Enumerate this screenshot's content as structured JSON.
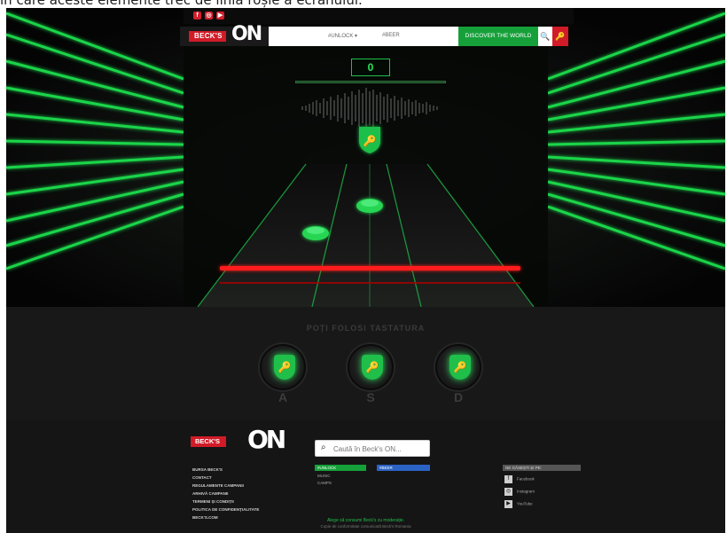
{
  "caption": "în care aceste elemente trec de linia roșie a ecranului.",
  "colors": {
    "accent": "#27e65a",
    "brand_red": "#d11b27",
    "discover_green": "#16a03a",
    "hit_line": "#ff1a1a"
  },
  "social": {
    "icons": [
      "facebook-icon",
      "instagram-icon",
      "youtube-icon"
    ],
    "glyphs": [
      "f",
      "◎",
      "▶"
    ]
  },
  "header": {
    "brand": "BECK'S",
    "on": "ON",
    "nav": [
      "#UNLOCK ▾",
      "#BEER"
    ],
    "discover": "DISCOVER THE WORLD",
    "search_glyph": "🔍",
    "menu_glyph": "🔑"
  },
  "game": {
    "score": "0",
    "progress": 0.0,
    "lanes": 3
  },
  "keys": {
    "title": "POȚI FOLOSI TASTATURA",
    "items": [
      {
        "letter": "A",
        "glyph": "🔑"
      },
      {
        "letter": "S",
        "glyph": "🔑"
      },
      {
        "letter": "D",
        "glyph": "🔑"
      }
    ]
  },
  "footer": {
    "brand": "BECK'S",
    "on": "ON",
    "links": [
      "BURSA BECK'S",
      "CONTACT",
      "REGULAMENTE CAMPANII",
      "ARHIVĂ CAMPANII",
      "TERMENI ȘI CONDIȚII",
      "POLITICA DE CONFIDENȚIALITATE",
      "BECK'S.COM"
    ],
    "search_placeholder": "Caută în Beck's ON...",
    "tags": [
      "#UNLOCK",
      "#BEER"
    ],
    "unlock_sub": [
      "MUSIC",
      "CAMPS"
    ],
    "follow_title": "NE GĂSEȘTI ȘI PE:",
    "follow": [
      {
        "icon": "facebook-icon",
        "glyph": "f",
        "label": "Facebook"
      },
      {
        "icon": "instagram-icon",
        "glyph": "◎",
        "label": "Instagram"
      },
      {
        "icon": "youtube-icon",
        "glyph": "▶",
        "label": "YouTube"
      }
    ],
    "note1": "Alege să consumi Beck's cu moderație.",
    "note2": "Copie de conformitate comunicată Beck's Romania"
  }
}
